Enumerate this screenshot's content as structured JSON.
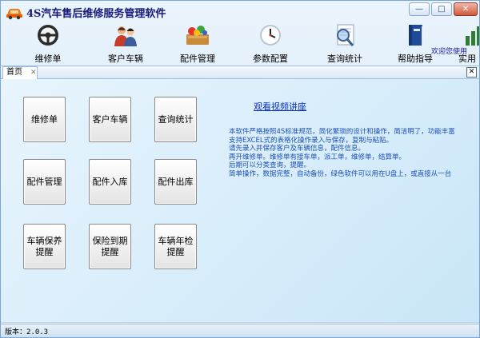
{
  "window": {
    "title": "4S汽车售后维修服务管理软件",
    "min_label": "—",
    "max_label": "□",
    "close_label": "✕"
  },
  "toolbar": {
    "items": [
      {
        "label": "维修单",
        "icon": "steering-wheel-icon"
      },
      {
        "label": "客户车辆",
        "icon": "customers-icon"
      },
      {
        "label": "配件管理",
        "icon": "parts-icon"
      },
      {
        "label": "参数配置",
        "icon": "clock-icon"
      },
      {
        "label": "查询统计",
        "icon": "magnifier-icon"
      },
      {
        "label": "帮助指导",
        "icon": "book-icon"
      },
      {
        "label": "实用",
        "icon": "chart-icon"
      }
    ],
    "welcome": "欢迎您使用"
  },
  "tabs": {
    "home": "首页",
    "close": "✕",
    "pane_close": "✕"
  },
  "buttons": [
    "维修单",
    "客户车辆",
    "查询统计",
    "配件管理",
    "配件入库",
    "配件出库",
    "车辆保养提醒",
    "保险到期提醒",
    "车辆年检提醒"
  ],
  "video_link": "观看视频讲座",
  "description": [
    "本软件严格按照4S标准规范，简化繁琐的设计和操作，简洁明了，功能丰富",
    "支持EXCEL式的表格化操作录入与保存，复制与粘贴。",
    "请先录入并保存客户及车辆信息，配件信息。",
    "再开维修单。维修单有接车单，派工单，维修单，结算单。",
    "后期可以分类查询，提醒。",
    "简单操作，数据完整，自动备份，绿色软件可以用在U盘上，或直接从一台"
  ],
  "status": {
    "version": "版本：2.0.3"
  },
  "colors": {
    "title": "#16187a",
    "link": "#0a2fc3",
    "description": "#1c4fb8"
  }
}
